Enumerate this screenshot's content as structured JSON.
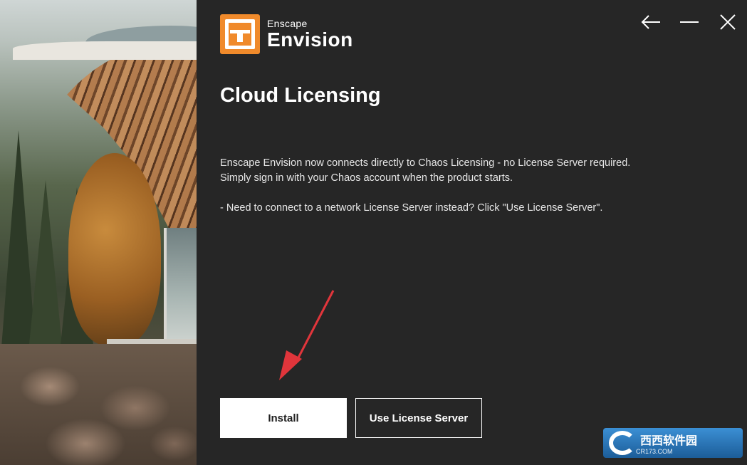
{
  "app": {
    "brand_small": "Enscape",
    "brand_big": "Envision"
  },
  "window_controls": {
    "back_icon": "arrow-left-icon",
    "minimize_icon": "minimize-icon",
    "close_icon": "close-icon"
  },
  "page": {
    "title": "Cloud Licensing",
    "paragraph1_line1": "Enscape Envision now connects directly to Chaos Licensing - no License Server required.",
    "paragraph1_line2": "Simply sign in with your Chaos account when the product starts.",
    "paragraph2": "- Need to connect to a network License Server instead? Click \"Use License Server\"."
  },
  "buttons": {
    "install": "Install",
    "use_license_server": "Use License Server"
  },
  "watermark": {
    "text": "西西软件园",
    "sub": "CR173.COM"
  },
  "colors": {
    "background": "#262626",
    "accent": "#f08a2b",
    "annotation_arrow": "#e0353b",
    "primary_button": "#ffffff"
  }
}
